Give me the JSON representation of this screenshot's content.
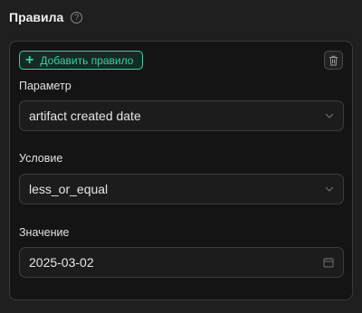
{
  "section": {
    "title": "Правила"
  },
  "rule": {
    "add_button_label": "Добавить правило",
    "parameter": {
      "label": "Параметр",
      "value": "artifact created date"
    },
    "condition": {
      "label": "Условие",
      "value": "less_or_equal"
    },
    "value": {
      "label": "Значение",
      "value": "2025-03-02"
    }
  },
  "colors": {
    "accent": "#3ad0a7",
    "background": "#1f1f1f",
    "card": "#141414",
    "border": "#3a3a3a"
  },
  "icons": {
    "help": "question-circle-icon",
    "add": "plus-icon",
    "delete": "trash-icon",
    "select": "chevron-down-icon",
    "date": "calendar-icon"
  }
}
